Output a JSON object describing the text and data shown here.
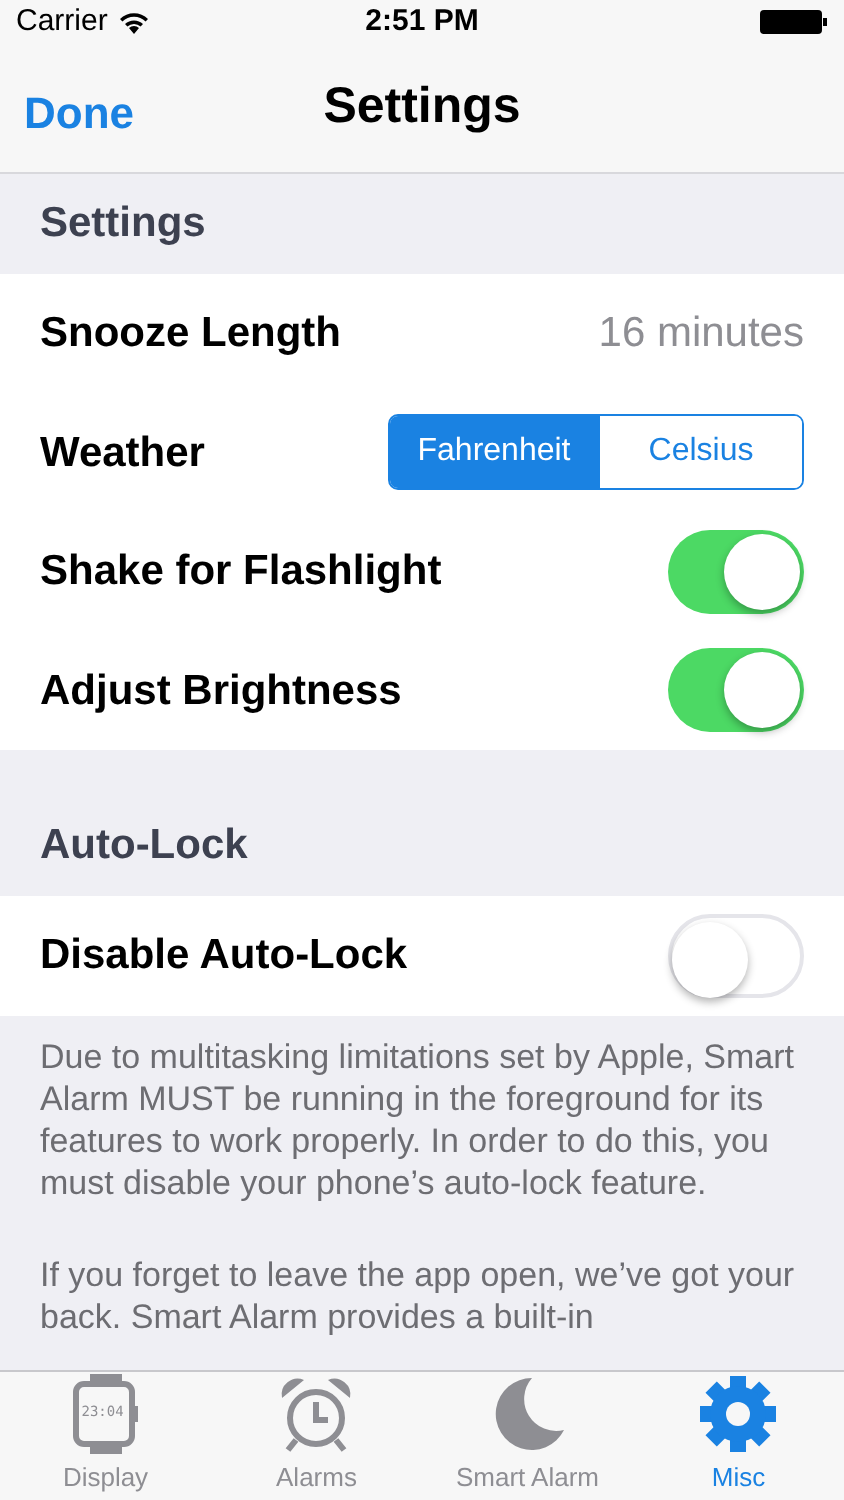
{
  "status_bar": {
    "carrier": "Carrier",
    "time": "2:51 PM"
  },
  "nav": {
    "left_button": "Done",
    "title": "Settings"
  },
  "sections": [
    {
      "header": "Settings",
      "rows": [
        {
          "kind": "value",
          "label": "Snooze Length",
          "value": "16 minutes"
        },
        {
          "kind": "segmented",
          "label": "Weather",
          "options": [
            {
              "label": "Fahrenheit",
              "selected": true
            },
            {
              "label": "Celsius",
              "selected": false
            }
          ]
        },
        {
          "kind": "toggle",
          "label": "Shake for Flashlight",
          "on": true
        },
        {
          "kind": "toggle",
          "label": "Adjust Brightness",
          "on": true
        }
      ]
    },
    {
      "header": "Auto-Lock",
      "rows": [
        {
          "kind": "toggle",
          "label": "Disable Auto-Lock",
          "on": false
        }
      ],
      "footer": [
        "Due to multitasking limitations set by Apple, Smart Alarm MUST be running in the foreground for its features to work properly.  In order to do this, you must disable your phone’s auto-lock feature.",
        "If you forget to leave the app open, we’ve got your back.  Smart Alarm provides a built-in"
      ]
    }
  ],
  "tab_bar": [
    {
      "kind": "watch",
      "label": "Display",
      "watch_time": "23:04",
      "selected": false
    },
    {
      "kind": "alarm",
      "label": "Alarms",
      "selected": false
    },
    {
      "kind": "moon",
      "label": "Smart Alarm",
      "selected": false
    },
    {
      "kind": "gear",
      "label": "Misc",
      "selected": true
    }
  ]
}
